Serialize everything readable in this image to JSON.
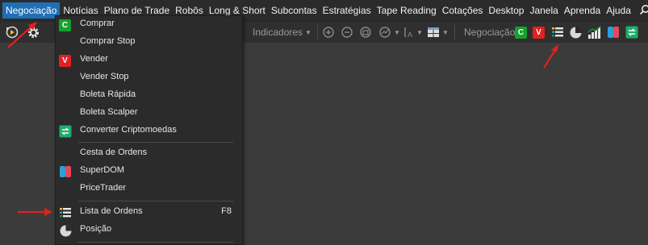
{
  "menubar": {
    "items": [
      "Negociação",
      "Notícias",
      "Plano de Trade",
      "Robôs",
      "Long & Short",
      "Subcontas",
      "Estratégias",
      "Tape Reading",
      "Cotações",
      "Desktop",
      "Janela",
      "Aprenda",
      "Ajuda"
    ],
    "active_index": 0
  },
  "toolbar": {
    "indicators_label": "Indicadores",
    "negociacao_label": "Negociação",
    "buy_letter": "C",
    "sell_letter": "V"
  },
  "dropdown": {
    "items": [
      {
        "label": "Comprar",
        "icon": "buy-icon",
        "letter": "C"
      },
      {
        "label": "Comprar Stop",
        "icon": ""
      },
      {
        "label": "Vender",
        "icon": "sell-icon",
        "letter": "V"
      },
      {
        "label": "Vender Stop",
        "icon": ""
      },
      {
        "label": "Boleta Rápida",
        "icon": ""
      },
      {
        "label": "Boleta Scalper",
        "icon": ""
      },
      {
        "label": "Converter Criptomoedas",
        "icon": "convert-crypto-icon"
      },
      {
        "label": "Cesta de Ordens",
        "icon": ""
      },
      {
        "label": "SuperDOM",
        "icon": "superdom-icon"
      },
      {
        "label": "PriceTrader",
        "icon": ""
      },
      {
        "label": "Lista de Ordens",
        "icon": "order-list-icon",
        "shortcut": "F8"
      },
      {
        "label": "Posição",
        "icon": "position-pie-icon"
      }
    ]
  },
  "colors": {
    "accent_blue": "#1f6fb5",
    "buy_green": "#13a22c",
    "sell_red": "#e0211f",
    "annotation_red": "#e0211f"
  }
}
